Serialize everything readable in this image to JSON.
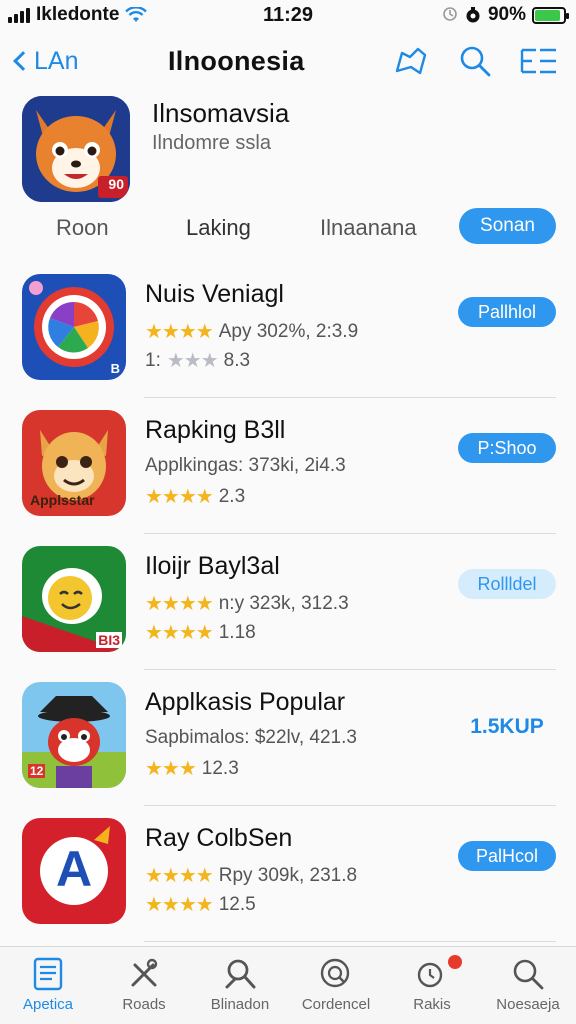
{
  "status_bar": {
    "carrier": "Ikledonte",
    "time": "11:29",
    "battery": "90%",
    "battery_level": 0.9
  },
  "nav": {
    "back_label": "LAn",
    "title": "Ilnoonesia"
  },
  "header_app": {
    "name": "Ilnsomavsia",
    "subtitle": "Ilndomre ssla",
    "badge": "90"
  },
  "tabs": {
    "items": [
      "Roon",
      "Laking",
      "Ilnaanana"
    ],
    "active": "Sonan"
  },
  "apps": [
    {
      "name": "Nuis Veniagl",
      "line1_text": "Apy 302%, 2:3.9",
      "line2_text": "1: 8.3",
      "line2_prefix": "1:",
      "line2_value": "8.3",
      "rating_line1": 4,
      "button": "Pallhlol",
      "button_style": "filled",
      "icon_name": "color-wheel-app-icon",
      "icon_badge": "B"
    },
    {
      "name": "Rapking B3ll",
      "line1_text": "Applkingas: 373ki, 2i4.3",
      "line2_value": "2.3",
      "button": "P:Shoo",
      "button_style": "filled",
      "icon_name": "cat-character-app-icon",
      "icon_label": "Applsstar"
    },
    {
      "name": "Iloijr Bayl3al",
      "line1_text": "n:y 323k, 312.3",
      "line2_value": "1.18",
      "button": "Rollldel",
      "button_style": "light",
      "icon_name": "green-chat-app-icon",
      "icon_badge": "BI3"
    },
    {
      "name": "Applkasis Popular",
      "line1_text": "Sapbimalos: $22lv, 421.3",
      "line2_value": "12.3",
      "button": "1.5KUP",
      "button_style": "plain",
      "icon_name": "fox-character-app-icon",
      "icon_badge": "12"
    },
    {
      "name": "Ray ColbSen",
      "line1_text": "Rpy 309k, 231.8",
      "line2_value": "12.5",
      "button": "PalHcol",
      "button_style": "filled",
      "icon_name": "letter-a-app-icon",
      "icon_letter": "A"
    }
  ],
  "tab_bar": [
    {
      "label": "Apetica",
      "icon": "document-icon",
      "active": true
    },
    {
      "label": "Roads",
      "icon": "tools-icon"
    },
    {
      "label": "Blinadon",
      "icon": "wrench-search-icon"
    },
    {
      "label": "Cordencel",
      "icon": "magnify-circle-icon"
    },
    {
      "label": "Rakis",
      "icon": "notification-icon"
    },
    {
      "label": "Noesaeja",
      "icon": "search-icon"
    }
  ],
  "colors": {
    "accent": "#2f97ee",
    "star": "#f3b51b",
    "badge": "#e53a2c"
  }
}
